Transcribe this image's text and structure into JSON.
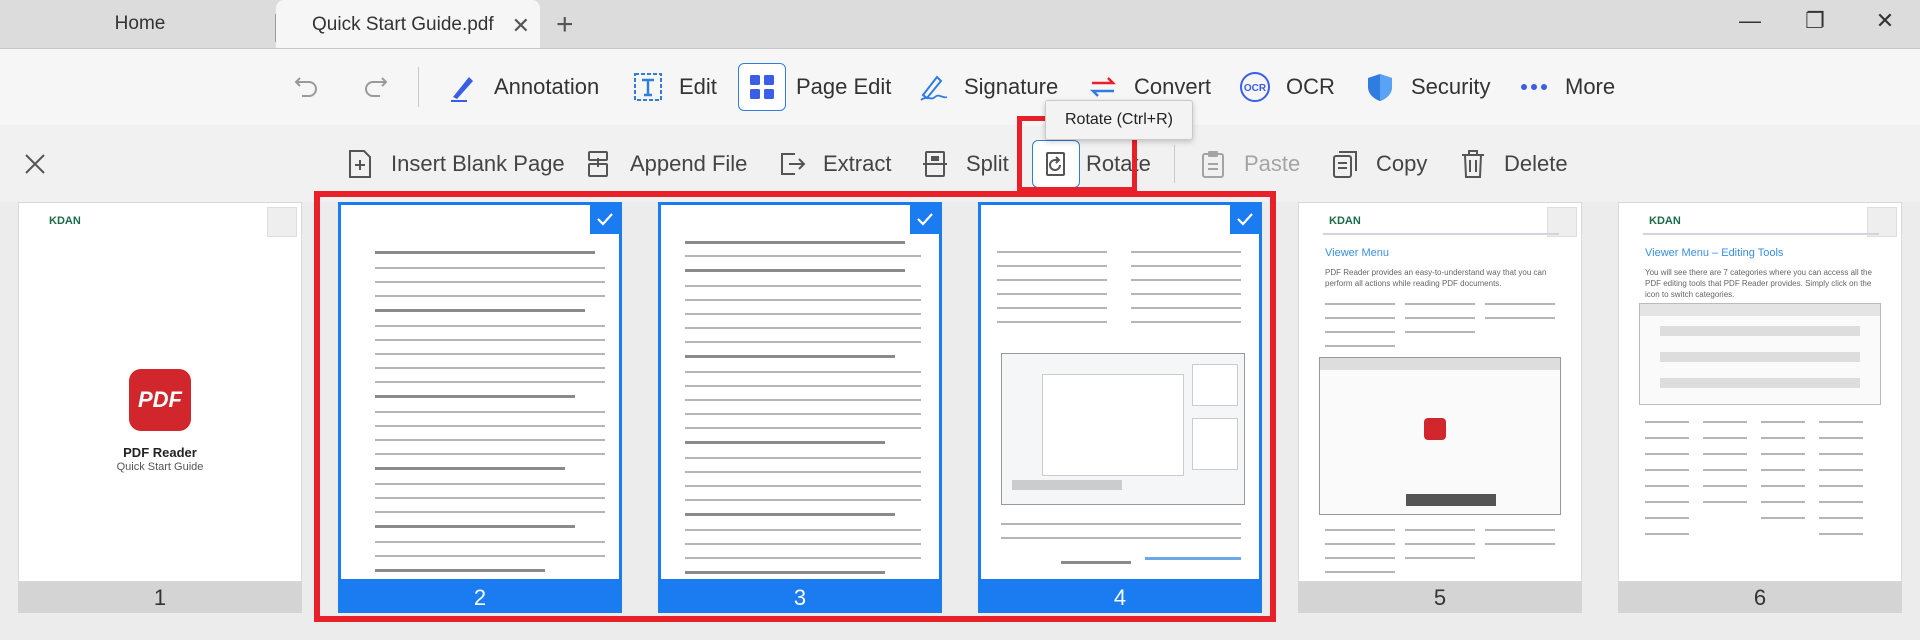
{
  "tabs": {
    "home": "Home",
    "active": "Quick Start Guide.pdf",
    "close": "✕",
    "new": "+"
  },
  "window": {
    "minimize": "—",
    "restore": "❐",
    "close": "✕"
  },
  "toolbar": {
    "annotation": "Annotation",
    "edit": "Edit",
    "page_edit": "Page Edit",
    "signature": "Signature",
    "convert": "Convert",
    "ocr": "OCR",
    "security": "Security",
    "more": "More"
  },
  "tooltip": "Rotate (Ctrl+R)",
  "subtoolbar": {
    "insert_blank_page": "Insert Blank Page",
    "append_file": "Append File",
    "extract": "Extract",
    "split": "Split",
    "rotate": "Rotate",
    "paste": "Paste",
    "copy": "Copy",
    "delete": "Delete"
  },
  "colors": {
    "accent": "#1a7cf0",
    "highlight": "#e8202a"
  },
  "pages": [
    {
      "number": "1",
      "selected": false,
      "brand": "KDAN",
      "app": "PDF Reader",
      "subtitle": "Quick Start Guide"
    },
    {
      "number": "2",
      "selected": true
    },
    {
      "number": "3",
      "selected": true
    },
    {
      "number": "4",
      "selected": true
    },
    {
      "number": "5",
      "selected": false,
      "brand": "KDAN",
      "heading": "Viewer Menu",
      "body": "PDF Reader provides an easy-to-understand way that you can perform all actions while reading PDF documents."
    },
    {
      "number": "6",
      "selected": false,
      "brand": "KDAN",
      "heading": "Viewer Menu – Editing Tools",
      "body": "You will see there are 7 categories where you can access all the PDF editing tools that PDF Reader provides. Simply click on the icon to switch categories."
    }
  ]
}
